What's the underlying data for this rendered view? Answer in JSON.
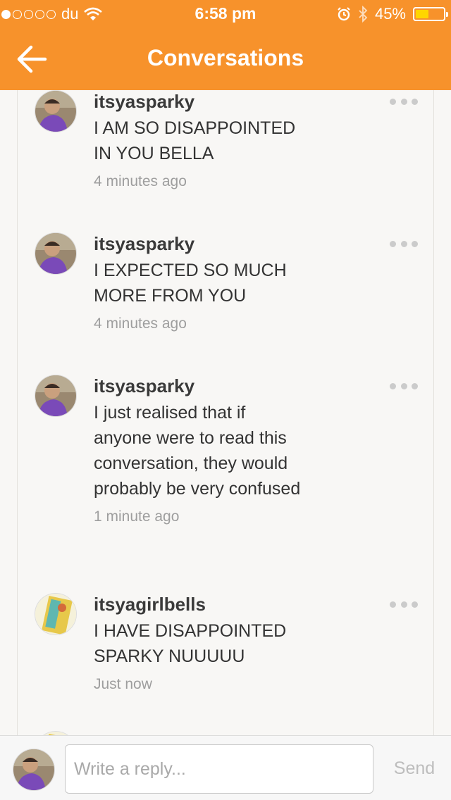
{
  "status_bar": {
    "carrier": "du",
    "time": "6:58 pm",
    "battery": "45%",
    "signal_bars_filled": 1,
    "signal_bars_total": 5,
    "battery_level": 0.45
  },
  "header": {
    "title": "Conversations",
    "back_icon": "arrow-left-icon",
    "background": "#f7922b"
  },
  "messages": [
    {
      "username": "itsyasparky",
      "text": "I AM SO DISAPPOINTED IN YOU BELLA",
      "time": "4 minutes ago",
      "avatar": "avatar-sparky"
    },
    {
      "username": "itsyasparky",
      "text": "I EXPECTED SO MUCH MORE FROM YOU",
      "time": "4 minutes ago",
      "avatar": "avatar-sparky"
    },
    {
      "username": "itsyasparky",
      "text": "I just realised that if anyone were to read this conversation, they would probably be very confused",
      "time": "1 minute ago",
      "avatar": "avatar-sparky"
    },
    {
      "username": "itsyagirlbells",
      "text": "I HAVE DISAPPOINTED SPARKY NUUUUU",
      "time": "Just now",
      "avatar": "avatar-bells"
    }
  ],
  "composer": {
    "placeholder": "Write a reply...",
    "value": "",
    "send_label": "Send"
  },
  "colors": {
    "accent": "#f7922b",
    "background": "#f8f7f5",
    "muted_text": "#9e9e9e"
  }
}
